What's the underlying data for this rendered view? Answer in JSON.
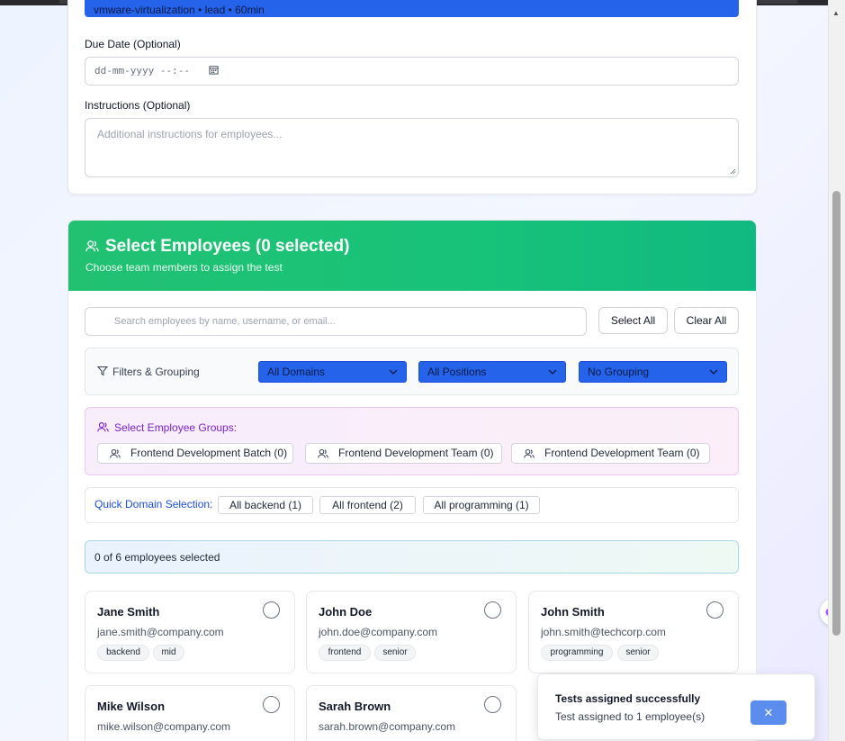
{
  "top_strip": {
    "text": "vmware-virtualization • lead • 60min"
  },
  "due_date": {
    "label": "Due Date (Optional)",
    "placeholder": "dd-mm-yyyy --:--"
  },
  "instructions": {
    "label": "Instructions (Optional)",
    "placeholder": "Additional instructions for employees..."
  },
  "select_section": {
    "title": "Select Employees (0 selected)",
    "subtitle": "Choose team members to assign the test"
  },
  "search": {
    "placeholder": "Search employees by name, username, or email..."
  },
  "actions": {
    "select_all": "Select All",
    "clear_all": "Clear All"
  },
  "filters": {
    "label": "Filters & Grouping",
    "domains": "All Domains",
    "positions": "All Positions",
    "grouping": "No Grouping"
  },
  "groups": {
    "title": "Select Employee Groups:",
    "items": [
      "Frontend Development Batch (0)",
      "Frontend Development Team (0)",
      "Frontend Development Team (0)"
    ]
  },
  "quick": {
    "label": "Quick Domain Selection:",
    "items": [
      "All backend (1)",
      "All frontend (2)",
      "All programming (1)"
    ]
  },
  "count_text": "0 of 6 employees selected",
  "employees": [
    {
      "name": "Jane Smith",
      "email": "jane.smith@company.com",
      "tags": [
        "backend",
        "mid"
      ]
    },
    {
      "name": "John Doe",
      "email": "john.doe@company.com",
      "tags": [
        "frontend",
        "senior"
      ]
    },
    {
      "name": "John Smith",
      "email": "john.smith@techcorp.com",
      "tags": [
        "programming",
        "senior"
      ]
    },
    {
      "name": "Mike Wilson",
      "email": "mike.wilson@company.com",
      "tags": []
    },
    {
      "name": "Sarah Brown",
      "email": "sarah.brown@company.com",
      "tags": []
    }
  ],
  "toast": {
    "title": "Tests assigned successfully",
    "description": "Test assigned to 1 employee(s)",
    "close": "✕"
  },
  "colors": {
    "primary": "#2563eb",
    "success": "#22c172",
    "purple": "#7e22ce"
  }
}
